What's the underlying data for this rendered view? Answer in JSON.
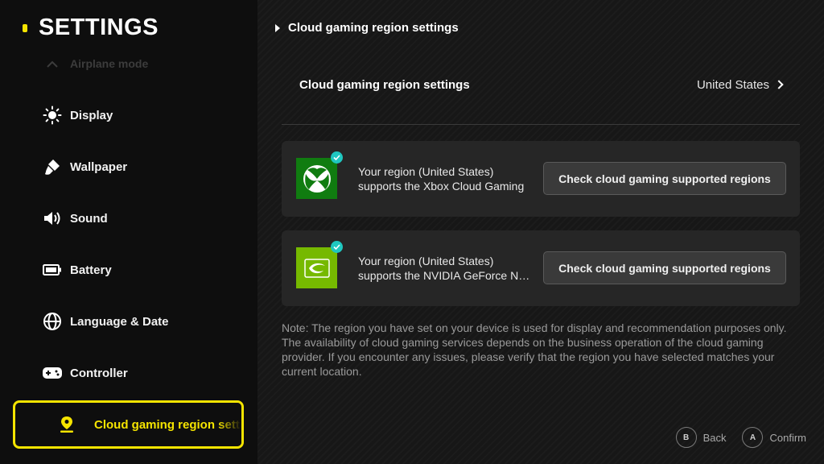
{
  "sidebar": {
    "title": "SETTINGS",
    "faded_item": "Airplane mode",
    "items": [
      {
        "label": "Display",
        "icon": "sun-icon"
      },
      {
        "label": "Wallpaper",
        "icon": "paint-brush-icon"
      },
      {
        "label": "Sound",
        "icon": "speaker-icon"
      },
      {
        "label": "Battery",
        "icon": "battery-icon"
      },
      {
        "label": "Language & Date",
        "icon": "globe-icon"
      },
      {
        "label": "Controller",
        "icon": "gamepad-icon"
      }
    ],
    "active_item": {
      "label": "Cloud gaming region settings",
      "icon": "location-pin-icon"
    }
  },
  "breadcrumb": "Cloud gaming region settings",
  "region_row": {
    "label": "Cloud gaming region settings",
    "value": "United States"
  },
  "cards": [
    {
      "logo": "xbox-logo-icon",
      "line1": "Your region (United States)",
      "line2": "supports the Xbox Cloud Gaming",
      "button": "Check cloud gaming supported regions"
    },
    {
      "logo": "nvidia-logo-icon",
      "line1": "Your region (United States)",
      "line2": "supports the NVIDIA GeForce NOW",
      "button": "Check cloud gaming supported regions"
    }
  ],
  "note": "Note: The region you have set on your device is used for display and recommendation purposes only. The availability of cloud gaming services depends on the business operation of the cloud gaming provider. If you encounter any issues, please verify that the region you have selected matches your current location.",
  "hints": [
    {
      "key": "B",
      "label": "Back"
    },
    {
      "key": "A",
      "label": "Confirm"
    }
  ],
  "colors": {
    "accent": "#f5e400",
    "xbox": "#107c10",
    "nvidia": "#76b900",
    "check_badge": "#1fc7c0"
  }
}
